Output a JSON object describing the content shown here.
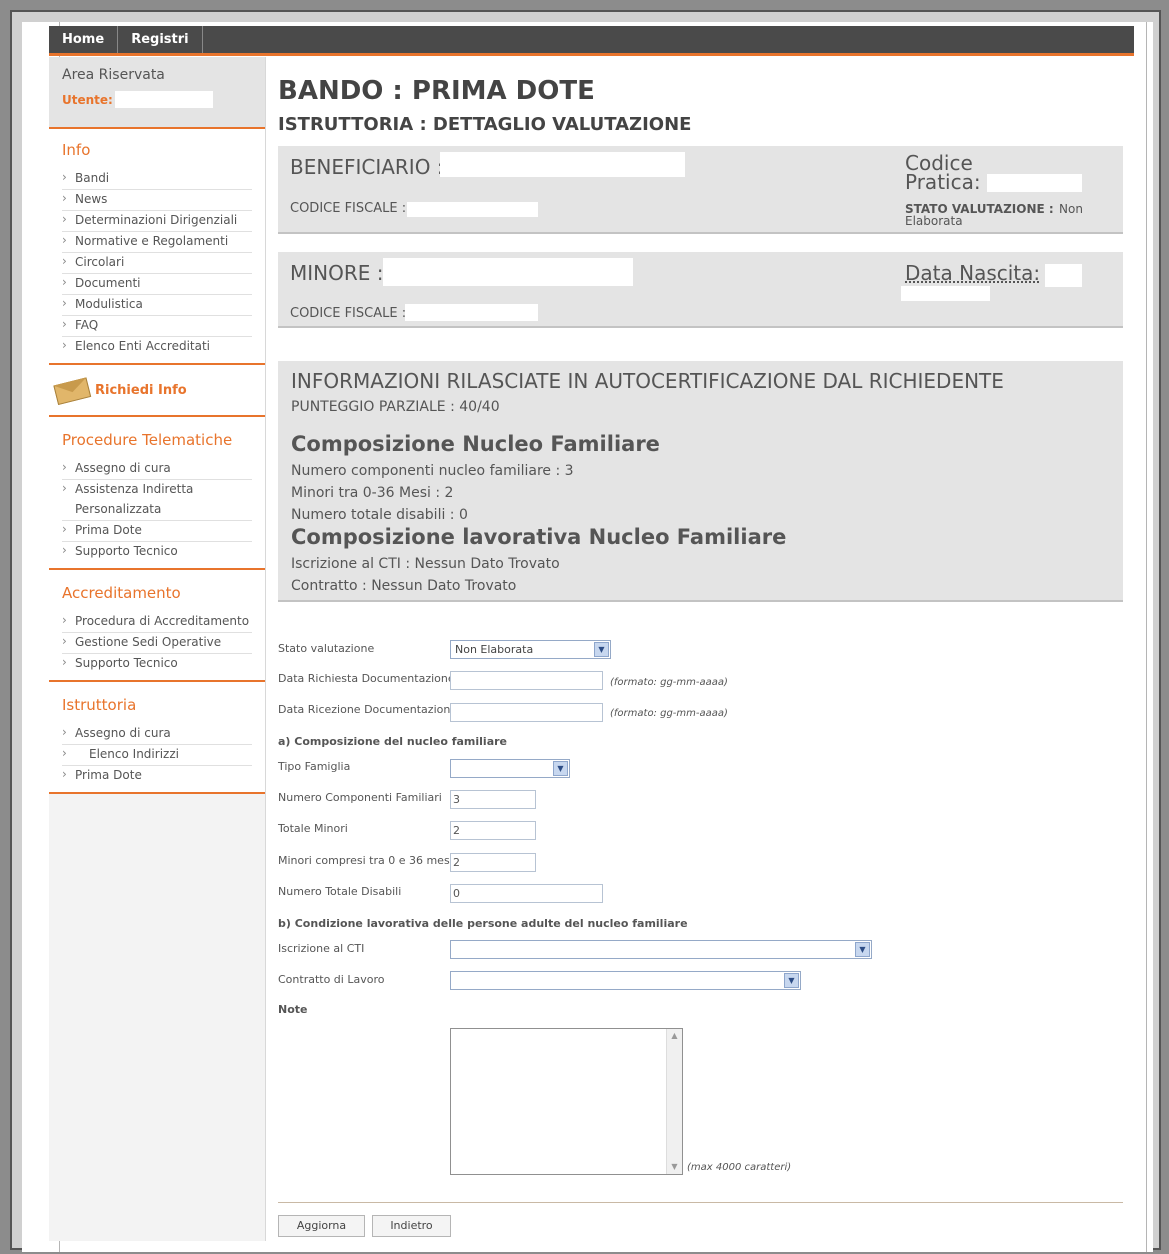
{
  "topnav": {
    "tabs": [
      "Home",
      "Registri"
    ]
  },
  "sidebar": {
    "area_title": "Area Riservata",
    "utente_label": "Utente:",
    "sections": [
      {
        "heading": "Info",
        "items": [
          "Bandi",
          "News",
          "Determinazioni Dirigenziali",
          "Normative e Regolamenti",
          "Circolari",
          "Documenti",
          "Modulistica",
          "FAQ",
          "Elenco Enti Accreditati"
        ]
      },
      {
        "heading": "Procedure Telematiche",
        "items": [
          "Assegno di cura",
          "Assistenza Indiretta",
          "Personalizzata",
          "Prima Dote",
          "Supporto Tecnico"
        ]
      },
      {
        "heading": "Accreditamento",
        "items": [
          "Procedura di Accreditamento",
          "Gestione Sedi Operative",
          "Supporto Tecnico"
        ]
      },
      {
        "heading": "Istruttoria",
        "items": [
          "Assegno di cura",
          "Elenco Indirizzi",
          "Prima Dote"
        ]
      }
    ],
    "richiedi_info": "Richiedi Info"
  },
  "main": {
    "title": "BANDO : PRIMA DOTE",
    "subtitle": "ISTRUTTORIA : DETTAGLIO VALUTAZIONE",
    "beneficiario": {
      "label": "BENEFICIARIO :",
      "codice_fiscale_label": "CODICE FISCALE :",
      "codice_pratica_label_1": "Codice",
      "codice_pratica_label_2": "Pratica:",
      "stato_label": "STATO VALUTAZIONE :",
      "stato_value_1": "Non",
      "stato_value_2": "Elaborata"
    },
    "minore": {
      "label": "MINORE :",
      "codice_fiscale_label": "CODICE FISCALE :",
      "data_nascita_label": "Data Nascita:"
    },
    "info": {
      "heading": "INFORMAZIONI RILASCIATE IN AUTOCERTIFICAZIONE DAL RICHIEDENTE",
      "punteggio": "PUNTEGGIO PARZIALE :  40/40",
      "composizione_heading": "Composizione Nucleo Familiare",
      "numero_componenti": "Numero componenti nucleo familiare :  3",
      "minori": "Minori tra 0-36 Mesi :  2",
      "disabili": "Numero totale disabili :  0",
      "lavorativa_heading": "Composizione lavorativa Nucleo Familiare",
      "cti": "Iscrizione al CTI :  Nessun Dato Trovato",
      "contratto": "Contratto :  Nessun Dato Trovato"
    }
  },
  "form": {
    "stato_label": "Stato valutazione",
    "stato_value": "Non Elaborata",
    "data_richiesta_label": "Data Richiesta Documentazione",
    "data_ricezione_label": "Data Ricezione Documentazione",
    "date_hint": "(formato: gg-mm-aaaa)",
    "section_a": "a) Composizione del nucleo familiare",
    "tipo_famiglia_label": "Tipo Famiglia",
    "numero_componenti_label": "Numero Componenti Familiari",
    "numero_componenti_value": "3",
    "totale_minori_label": "Totale Minori",
    "totale_minori_value": "2",
    "minori_036_label": "Minori compresi tra 0 e 36 mesi",
    "minori_036_value": "2",
    "disabili_label": "Numero Totale Disabili",
    "disabili_value": "0",
    "section_b": "b) Condizione lavorativa delle persone adulte del nucleo familiare",
    "cti_label": "Iscrizione al CTI",
    "contratto_label": "Contratto di Lavoro",
    "note_label": "Note",
    "note_hint": "(max 4000 caratteri)",
    "aggiorna": "Aggiorna",
    "indietro": "Indietro"
  },
  "colors": {
    "accent": "#e8742c",
    "panel": "#e4e4e4",
    "nav": "#4a4a4a"
  }
}
